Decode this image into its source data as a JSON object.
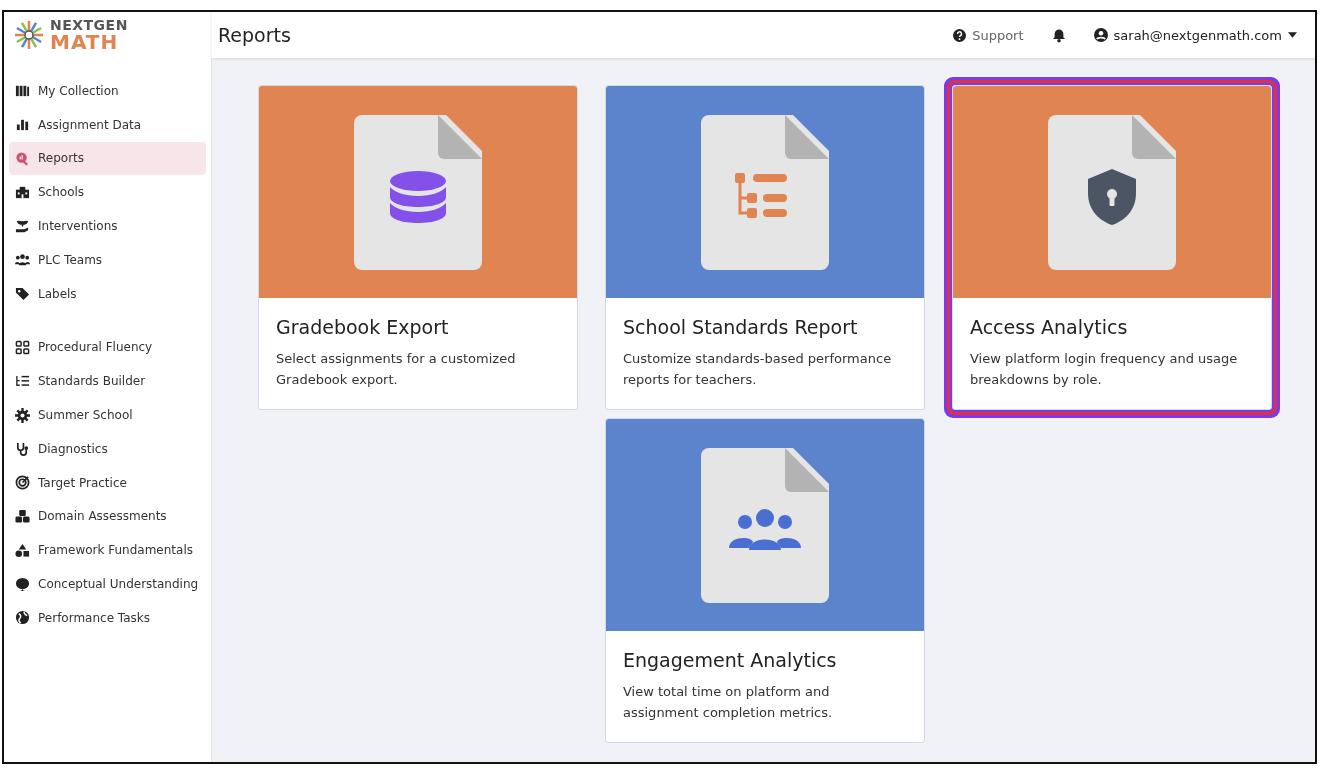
{
  "logo": {
    "top": "NEXTGEN",
    "bottom": "MATH"
  },
  "header": {
    "title": "Reports",
    "support": "Support",
    "user": "sarah@nextgenmath.com"
  },
  "sidebar": {
    "groups": [
      {
        "items": [
          {
            "label": "My Collection",
            "selected": false
          },
          {
            "label": "Assignment Data",
            "selected": false
          },
          {
            "label": "Reports",
            "selected": true
          },
          {
            "label": "Schools",
            "selected": false
          },
          {
            "label": "Interventions",
            "selected": false
          },
          {
            "label": "PLC Teams",
            "selected": false
          },
          {
            "label": "Labels",
            "selected": false
          }
        ]
      },
      {
        "items": [
          {
            "label": "Procedural Fluency",
            "selected": false
          },
          {
            "label": "Standards Builder",
            "selected": false
          },
          {
            "label": "Summer School",
            "selected": false
          },
          {
            "label": "Diagnostics",
            "selected": false
          },
          {
            "label": "Target Practice",
            "selected": false
          },
          {
            "label": "Domain Assessments",
            "selected": false
          },
          {
            "label": "Framework Fundamentals",
            "selected": false
          },
          {
            "label": "Conceptual Understanding",
            "selected": false
          },
          {
            "label": "Performance Tasks",
            "selected": false
          }
        ]
      }
    ]
  },
  "cards": [
    {
      "title": "Gradebook Export",
      "description": "Select assignments for a customized Gradebook export.",
      "color": "#e08452",
      "kind": "database",
      "selected": false
    },
    {
      "title": "School Standards Report",
      "description": "Customize standards-based performance reports for teachers.",
      "color": "#5b84cc",
      "kind": "hierarchy",
      "selected": false
    },
    {
      "title": "Access Analytics",
      "description": "View platform login frequency and usage breakdowns by role.",
      "color": "#e08452",
      "kind": "shield",
      "selected": true
    },
    {
      "title": "Engagement Analytics",
      "description": "View total time on platform and assignment completion metrics.",
      "color": "#5b84cc",
      "kind": "users",
      "selected": false
    }
  ]
}
